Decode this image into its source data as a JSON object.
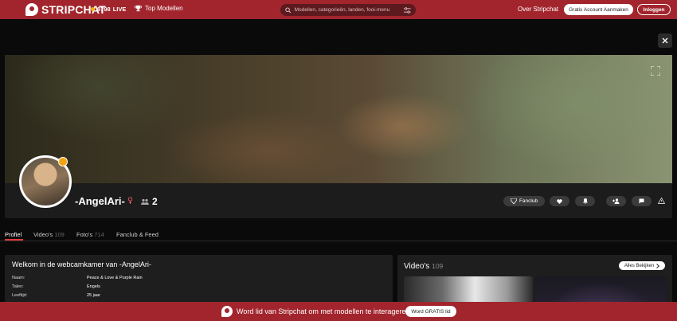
{
  "header": {
    "logo": "STRIPCHAT",
    "live_count": "8798",
    "live_label": "LIVE",
    "top_models": "Top Modellen",
    "search_placeholder": "Modellen, categorieën, landen, fooi-menu",
    "about": "Over Stripchat",
    "signup": "Gratis Account Aanmaken",
    "login": "Inloggen"
  },
  "profile": {
    "name": "-AngelAri-",
    "viewers": "2",
    "fanclub": "Fanclub"
  },
  "tabs": [
    {
      "label": "Profiel",
      "count": ""
    },
    {
      "label": "Video's",
      "count": "109"
    },
    {
      "label": "Foto's",
      "count": "714"
    },
    {
      "label": "Fanclub & Feed",
      "count": ""
    }
  ],
  "info": {
    "title": "Welkom in de webcamkamer van -AngelAri-",
    "rows": [
      {
        "key": "Naam:",
        "value": "Peace & Love & Purple Rain"
      },
      {
        "key": "Talen:",
        "value": "Engels"
      },
      {
        "key": "Leeftijd:",
        "value": "25 jaar"
      }
    ]
  },
  "videos": {
    "title": "Video's",
    "count": "109",
    "see_all": "Alles Bekijken"
  },
  "banner": {
    "text": "Word lid van Stripchat om met modellen te interageren.",
    "button": "Word GRATIS lid"
  }
}
